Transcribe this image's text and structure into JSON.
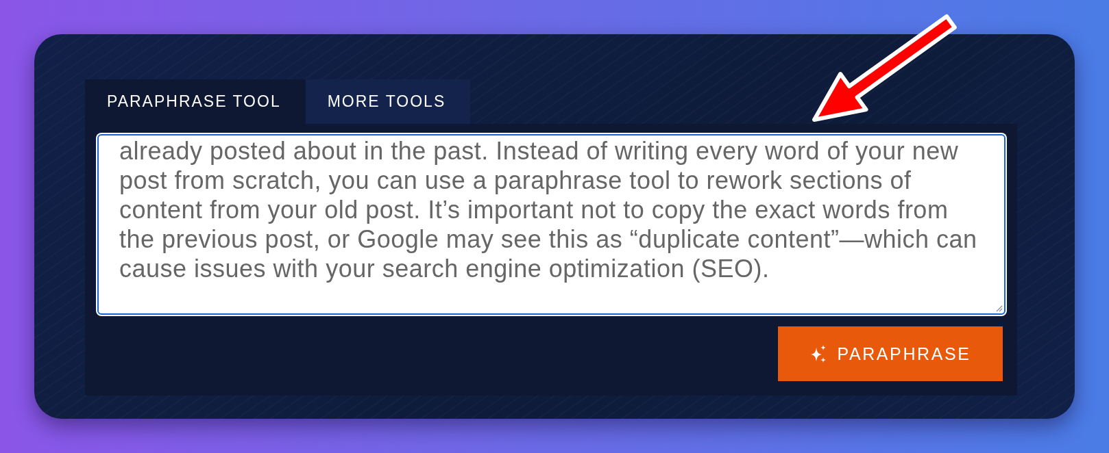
{
  "tabs": [
    {
      "label": "PARAPHRASE TOOL",
      "selected": true
    },
    {
      "label": "MORE TOOLS",
      "selected": false
    }
  ],
  "editor": {
    "value": "already posted about in the past. Instead of writing every word of your new post from scratch, you can use a paraphrase tool to rework sections of content from your old post. It’s important not to copy the exact words from the previous post, or Google may see this as “duplicate content”—which can cause issues with your search engine optimization (SEO)."
  },
  "paraphrase_button": {
    "label": "PARAPHRASE"
  }
}
